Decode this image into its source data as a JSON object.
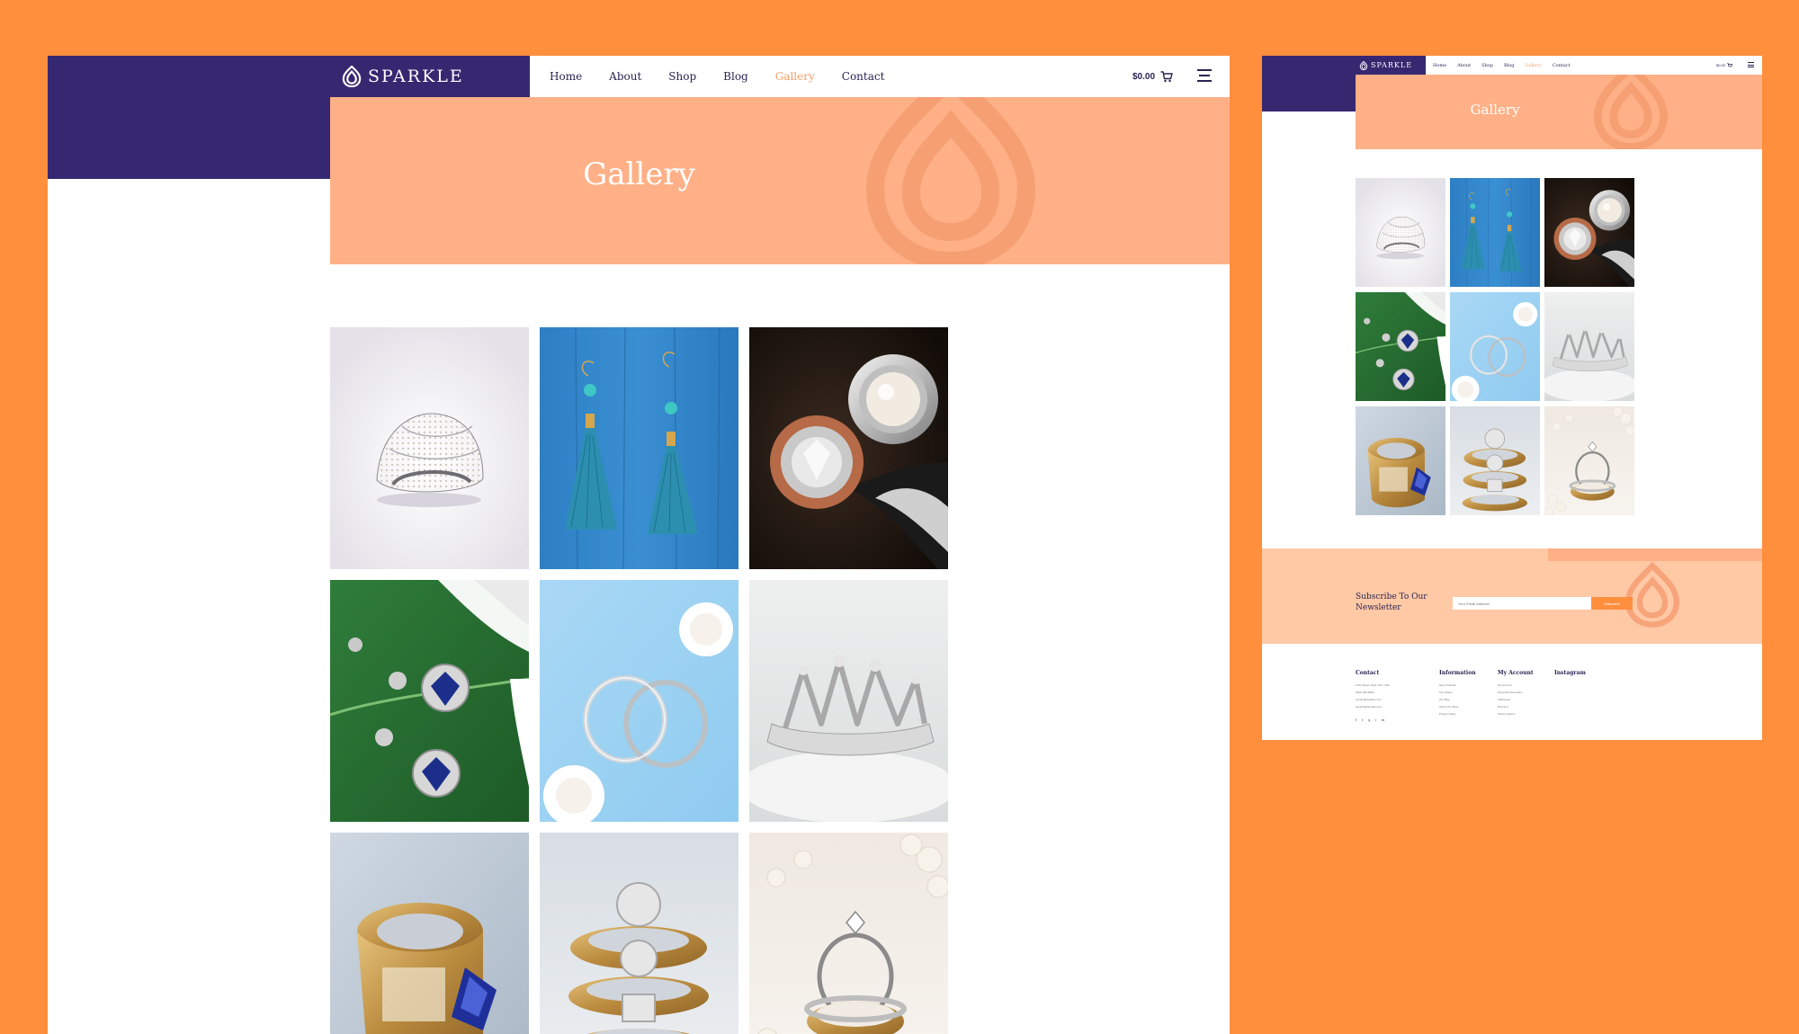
{
  "brand": {
    "name": "SPARKLE"
  },
  "nav": {
    "items": [
      {
        "label": "Home",
        "active": false
      },
      {
        "label": "About",
        "active": false
      },
      {
        "label": "Shop",
        "active": false
      },
      {
        "label": "Blog",
        "active": false
      },
      {
        "label": "Gallery",
        "active": true
      },
      {
        "label": "Contact",
        "active": false
      }
    ]
  },
  "cart": {
    "total": "$0.00",
    "icon": "cart-icon"
  },
  "menu": {
    "icon": "hamburger-menu-icon"
  },
  "hero": {
    "title": "Gallery"
  },
  "gallery": {
    "images": [
      {
        "name": "gallery-image-diamond-ring",
        "subject": "pave diamond ring on white"
      },
      {
        "name": "gallery-image-tassel-earrings",
        "subject": "turquoise tassel earrings on blue wood"
      },
      {
        "name": "gallery-image-pearl-ring",
        "subject": "pearl and rose gold rings on dark"
      },
      {
        "name": "gallery-image-sapphire-earrings",
        "subject": "sapphire drop earrings on green leaf"
      },
      {
        "name": "gallery-image-hoop-earrings",
        "subject": "silver hoop earrings on light blue"
      },
      {
        "name": "gallery-image-tiara",
        "subject": "crystal tiara on white"
      },
      {
        "name": "gallery-image-gold-sapphire-ring",
        "subject": "gold ring with blue sapphire"
      },
      {
        "name": "gallery-image-stacked-gold-rings",
        "subject": "stacked gold diamond rings"
      },
      {
        "name": "gallery-image-wedding-rings",
        "subject": "wedding ring set with pearls"
      }
    ]
  },
  "newsletter": {
    "title": "Subscribe To Our Newsletter",
    "input_placeholder": "Your Email Address",
    "button_label": "Subscribe"
  },
  "footer": {
    "columns": [
      {
        "title": "Contact",
        "links": [
          "1234 Street, New York, USA",
          "(000) 000-0000",
          "contact@sparkle.com",
          "support@sparkle.com"
        ]
      },
      {
        "title": "Information",
        "links": [
          "New Products",
          "Top Sellers",
          "Our Blog",
          "About Our Shop",
          "Privacy Policy"
        ]
      },
      {
        "title": "My Account",
        "links": [
          "My Account",
          "Personal Information",
          "Addresses",
          "Discount",
          "Orders History"
        ]
      },
      {
        "title": "Instagram",
        "links": []
      }
    ],
    "social": [
      "f",
      "t",
      "y",
      "i",
      "in"
    ]
  },
  "colors": {
    "background": "#FF8E3D",
    "brand_purple": "#362870",
    "hero_peach": "#FFB086",
    "newsletter_peach": "#FFC9A6",
    "active_link": "#F5A26B"
  }
}
